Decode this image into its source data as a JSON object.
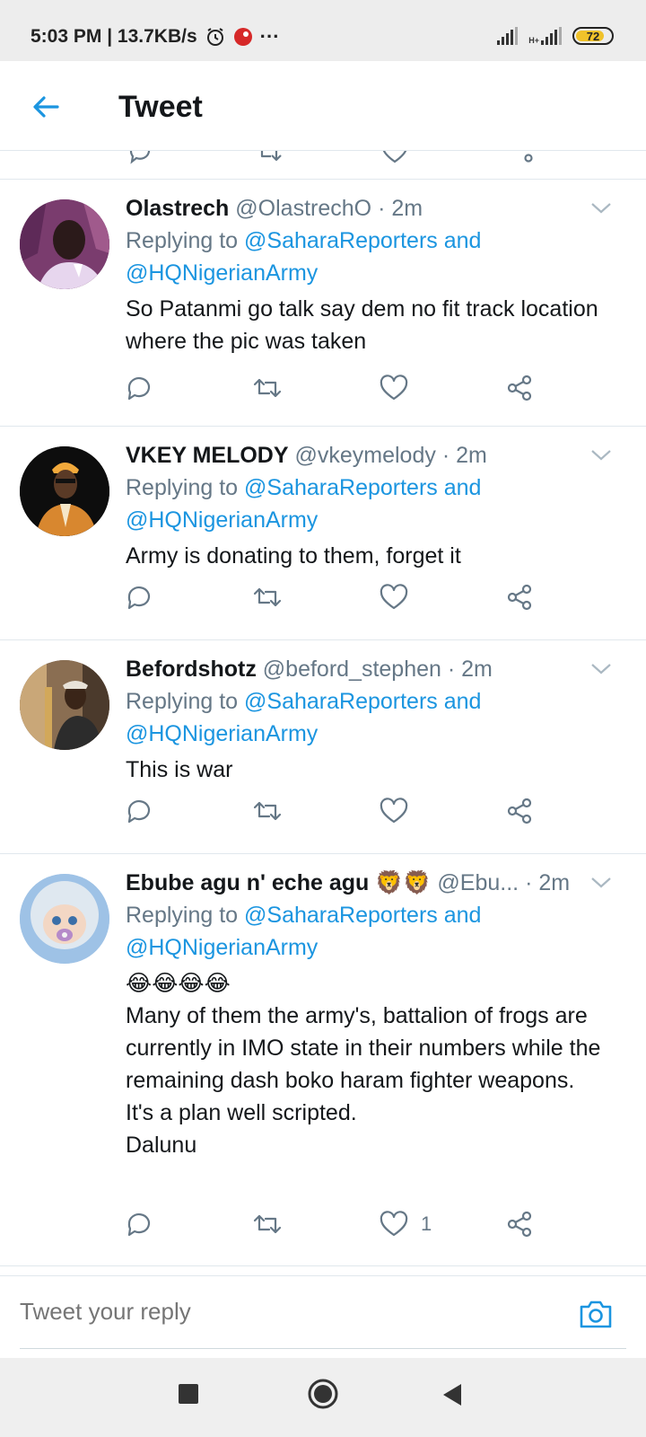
{
  "status_bar": {
    "time_and_speed": "5:03 PM | 13.7KB/s",
    "network_label": "H+",
    "battery": "72",
    "more": "···"
  },
  "header": {
    "title": "Tweet"
  },
  "colors": {
    "accent": "#1b95e0",
    "secondary_text": "#657786",
    "divider": "#e1e8ed"
  },
  "tweets": [
    {
      "name": "Olastrech",
      "handle": "@OlastrechO",
      "time": "· 2m",
      "replying_prefix": "Replying to",
      "mention1": "@SaharaReporters and",
      "mention2": "@HQNigerianArmy",
      "text": "So Patanmi go talk say dem no fit track location where the pic was taken",
      "likes": ""
    },
    {
      "name": "VKEY MELODY",
      "handle": "@vkeymelody",
      "time": "· 2m",
      "replying_prefix": "Replying to",
      "mention1": "@SaharaReporters and",
      "mention2": "@HQNigerianArmy",
      "text": "Army is donating to them, forget it",
      "likes": ""
    },
    {
      "name": "Befordshotz",
      "handle": "@beford_stephen",
      "time": "· 2m",
      "replying_prefix": "Replying to",
      "mention1": "@SaharaReporters and",
      "mention2": "@HQNigerianArmy",
      "text": "This is war",
      "likes": ""
    },
    {
      "name": "Ebube agu n' eche agu 🦁🦁",
      "handle": "@Ebu...",
      "time": "· 2m",
      "replying_prefix": "Replying to",
      "mention1": "@SaharaReporters and",
      "mention2": "@HQNigerianArmy",
      "emoji_line": "😂😂😂😂",
      "text": "Many of them the army's, battalion of frogs are currently in IMO state in their numbers while the remaining dash boko haram fighter weapons.\nIt's a plan well scripted.\nDalunu",
      "likes": "1"
    }
  ],
  "reply_bar": {
    "placeholder": "Tweet your reply"
  }
}
